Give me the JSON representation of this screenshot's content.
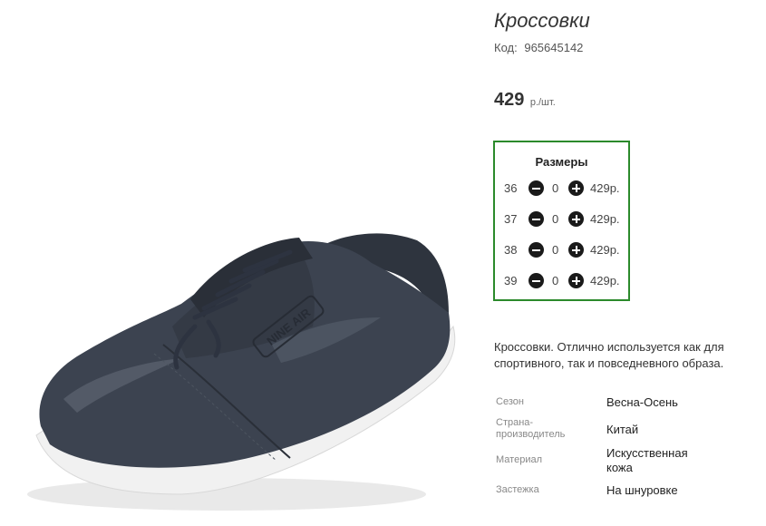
{
  "product": {
    "title": "Кроссовки",
    "code_label": "Код:",
    "code_value": "965645142",
    "price_value": "429",
    "price_unit": "р./шт.",
    "description": "Кроссовки. Отлично используется как для спортивного, так и повседневного образа.",
    "image_logo_text": "NINE AIR"
  },
  "sizes": {
    "title": "Размеры",
    "rows": [
      {
        "size": "36",
        "qty": "0",
        "price": "429р."
      },
      {
        "size": "37",
        "qty": "0",
        "price": "429р."
      },
      {
        "size": "38",
        "qty": "0",
        "price": "429р."
      },
      {
        "size": "39",
        "qty": "0",
        "price": "429р."
      }
    ]
  },
  "properties": [
    {
      "label": "Сезон",
      "value": "Весна-Осень"
    },
    {
      "label": "Страна-производитель",
      "value": "Китай"
    },
    {
      "label": "Материал",
      "value": "Искусственная кожа"
    },
    {
      "label": "Застежка",
      "value": "На шнуровке"
    }
  ],
  "colors": {
    "sizes_border": "#2b8a2b",
    "button_dark": "#1a1a1a",
    "shoe_body": "#3c4350",
    "sole": "#f1f1f1"
  }
}
